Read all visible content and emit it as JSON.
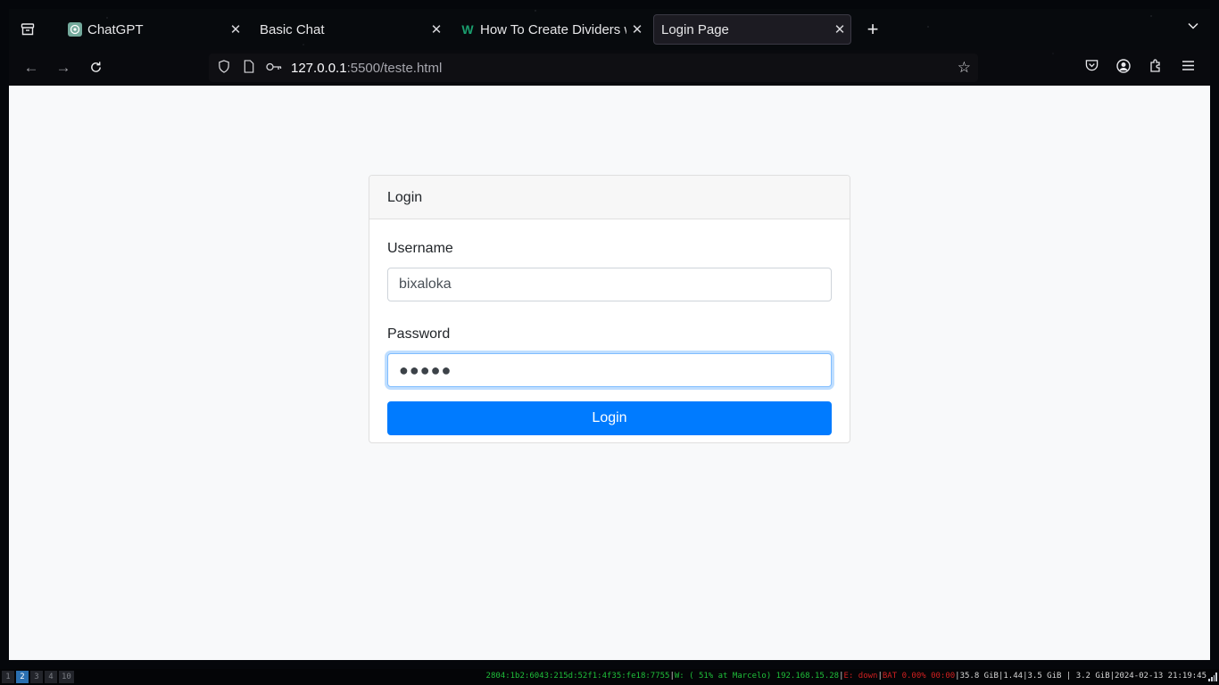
{
  "browser": {
    "tabs": [
      {
        "title": "ChatGPT",
        "favicon": "chatgpt-icon",
        "active": false
      },
      {
        "title": "Basic Chat",
        "favicon": "",
        "active": false
      },
      {
        "title": "How To Create Dividers w",
        "favicon": "w-icon",
        "active": false
      },
      {
        "title": "Login Page",
        "favicon": "",
        "active": true
      }
    ],
    "url_host": "127.0.0.1",
    "url_rest": ":5500/teste.html"
  },
  "login": {
    "header": "Login",
    "username_label": "Username",
    "username_value": "bixaloka",
    "password_label": "Password",
    "password_mask": "●●●●●",
    "submit_label": "Login"
  },
  "taskbar": {
    "workspaces": [
      "1",
      "2",
      "3",
      "4",
      "10"
    ],
    "active_workspace": "2",
    "ipv6": "2804:1b2:6043:215d:52f1:4f35:fe18:7755",
    "wifi": "W: ( 51% at Marcelo) 192.168.15.28",
    "ethernet": "E: down",
    "battery": "BAT 0.00% 00:00",
    "disk": "35.8 GiB",
    "load": "1.44",
    "mem_used": "3.5 GiB",
    "mem_free": "3.2 GiB",
    "datetime": "2024-02-13 21:19:45"
  },
  "colors": {
    "primary": "#007bff",
    "focus_ring": "#80bdff",
    "page_bg": "#f8f9fa"
  }
}
